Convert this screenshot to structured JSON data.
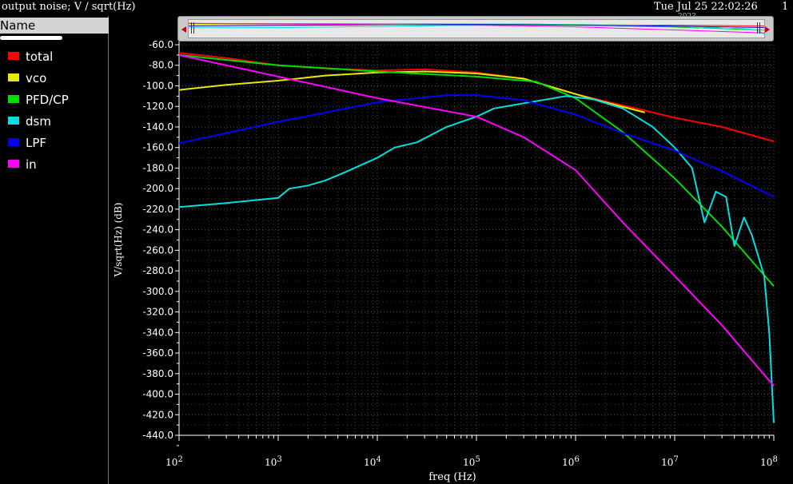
{
  "header": {
    "title": "output noise; V / sqrt(Hz)",
    "date": "Tue Jul 25 22:02:26",
    "date_sub": "2023",
    "page": "1"
  },
  "legend": {
    "header": "Name",
    "items": [
      {
        "label": "total",
        "color": "#ff0000"
      },
      {
        "label": "vco",
        "color": "#e8e800"
      },
      {
        "label": "PFD/CP",
        "color": "#00dd00"
      },
      {
        "label": "dsm",
        "color": "#00e0e0"
      },
      {
        "label": "LPF",
        "color": "#0000ff"
      },
      {
        "label": "in",
        "color": "#ff00ff"
      }
    ]
  },
  "chart_data": {
    "type": "line",
    "xlabel": "freq (Hz)",
    "ylabel": "V/sqrt(Hz) (dB)",
    "xscale": "log",
    "xlim": [
      100,
      100000000
    ],
    "ylim": [
      -440,
      -60
    ],
    "grid": true,
    "xticks": [
      {
        "base": "10",
        "exp": "2",
        "value": 100
      },
      {
        "base": "10",
        "exp": "3",
        "value": 1000
      },
      {
        "base": "10",
        "exp": "4",
        "value": 10000
      },
      {
        "base": "10",
        "exp": "5",
        "value": 100000
      },
      {
        "base": "10",
        "exp": "6",
        "value": 1000000
      },
      {
        "base": "10",
        "exp": "7",
        "value": 10000000
      },
      {
        "base": "10",
        "exp": "8",
        "value": 100000000
      }
    ],
    "yticks": [
      "-60.0",
      "-80.0",
      "-100.0",
      "-120.0",
      "-140.0",
      "-160.0",
      "-180.0",
      "-200.0",
      "-220.0",
      "-240.0",
      "-260.0",
      "-280.0",
      "-300.0",
      "-320.0",
      "-340.0",
      "-360.0",
      "-380.0",
      "-400.0",
      "-420.0",
      "-440.0"
    ],
    "series": [
      {
        "name": "total",
        "color": "#ff0000",
        "points": [
          [
            100,
            -68
          ],
          [
            300,
            -73
          ],
          [
            1000,
            -80
          ],
          [
            3000,
            -83
          ],
          [
            10000,
            -85
          ],
          [
            30000,
            -84
          ],
          [
            100000,
            -87
          ],
          [
            300000,
            -93
          ],
          [
            1000000,
            -108
          ],
          [
            2000000,
            -115
          ],
          [
            5000000,
            -124
          ],
          [
            10000000,
            -131
          ],
          [
            30000000,
            -140
          ],
          [
            100000000,
            -154
          ]
        ]
      },
      {
        "name": "vco",
        "color": "#e8e800",
        "points": [
          [
            100,
            -104
          ],
          [
            300,
            -99
          ],
          [
            1000,
            -95
          ],
          [
            3000,
            -90
          ],
          [
            10000,
            -87
          ],
          [
            30000,
            -86
          ],
          [
            100000,
            -88
          ],
          [
            300000,
            -93
          ],
          [
            1000000,
            -108
          ],
          [
            2000000,
            -116
          ],
          [
            5000000,
            -126
          ]
        ]
      },
      {
        "name": "PFD/CP",
        "color": "#00dd00",
        "points": [
          [
            100,
            -70
          ],
          [
            1000,
            -80
          ],
          [
            10000,
            -86
          ],
          [
            100000,
            -91
          ],
          [
            400000,
            -96
          ],
          [
            1000000,
            -112
          ],
          [
            3000000,
            -145
          ],
          [
            10000000,
            -190
          ],
          [
            30000000,
            -237
          ],
          [
            100000000,
            -295
          ]
        ]
      },
      {
        "name": "dsm",
        "color": "#00e0e0",
        "points": [
          [
            100,
            -218
          ],
          [
            300,
            -214
          ],
          [
            1000,
            -209
          ],
          [
            1300,
            -200
          ],
          [
            2000,
            -197
          ],
          [
            3000,
            -192
          ],
          [
            5000,
            -183
          ],
          [
            10000,
            -170
          ],
          [
            15000,
            -160
          ],
          [
            25000,
            -155
          ],
          [
            50000,
            -140
          ],
          [
            100000,
            -130
          ],
          [
            150000,
            -122
          ],
          [
            300000,
            -117
          ],
          [
            800000,
            -110
          ],
          [
            1500000,
            -113
          ],
          [
            3000000,
            -122
          ],
          [
            6000000,
            -140
          ],
          [
            10000000,
            -160
          ],
          [
            15000000,
            -180
          ],
          [
            20000000,
            -233
          ],
          [
            26000000,
            -203
          ],
          [
            33000000,
            -208
          ],
          [
            40000000,
            -256
          ],
          [
            50000000,
            -228
          ],
          [
            60000000,
            -245
          ],
          [
            80000000,
            -285
          ],
          [
            90000000,
            -340
          ],
          [
            100000000,
            -428
          ]
        ]
      },
      {
        "name": "LPF",
        "color": "#0000ff",
        "points": [
          [
            100,
            -156
          ],
          [
            1000,
            -135
          ],
          [
            10000,
            -116
          ],
          [
            50000,
            -109
          ],
          [
            100000,
            -109
          ],
          [
            300000,
            -114
          ],
          [
            1000000,
            -128
          ],
          [
            3000000,
            -146
          ],
          [
            10000000,
            -163
          ],
          [
            30000000,
            -183
          ],
          [
            100000000,
            -208
          ]
        ]
      },
      {
        "name": "in",
        "color": "#ff00ff",
        "points": [
          [
            100,
            -70
          ],
          [
            1000,
            -91
          ],
          [
            10000,
            -112
          ],
          [
            100000,
            -130
          ],
          [
            300000,
            -150
          ],
          [
            1000000,
            -182
          ],
          [
            3000000,
            -233
          ],
          [
            10000000,
            -285
          ],
          [
            30000000,
            -333
          ],
          [
            100000000,
            -392
          ]
        ]
      }
    ]
  }
}
